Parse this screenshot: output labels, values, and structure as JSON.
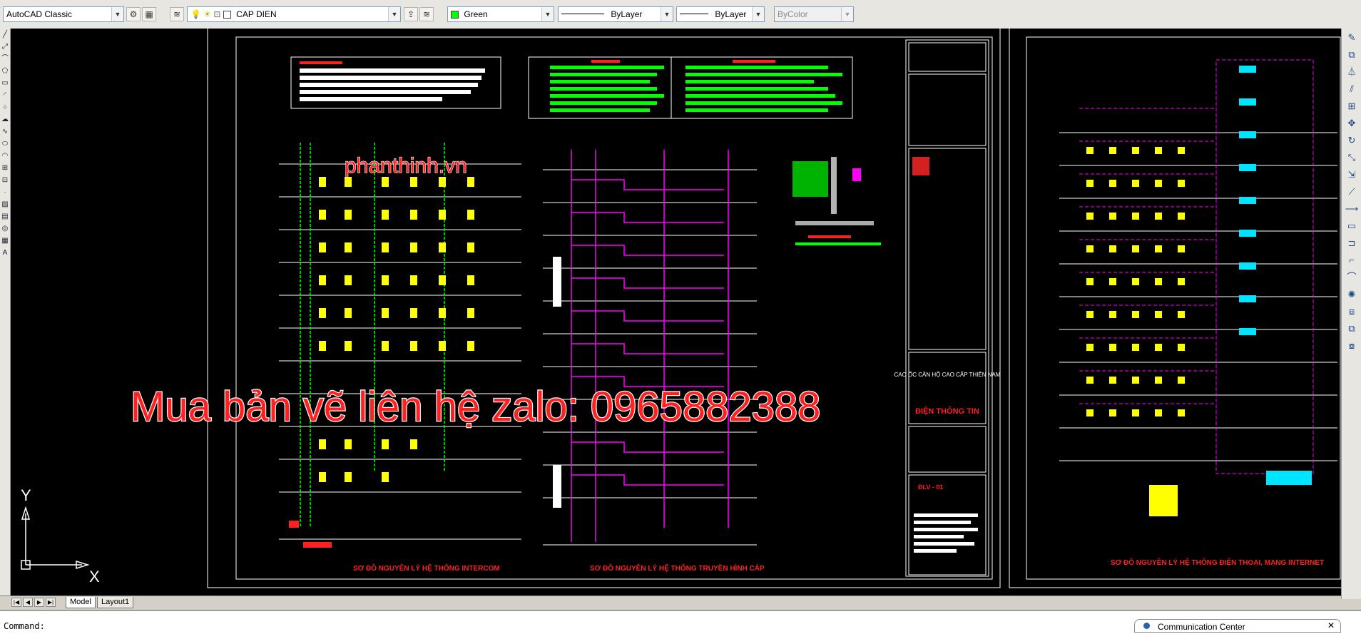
{
  "toolbar": {
    "workspace": "AutoCAD Classic",
    "layer": "CAP DIEN",
    "color": "Green",
    "color_hex": "#00ff00",
    "linetype": "ByLayer",
    "lineweight": "ByLayer",
    "plotstyle": "ByColor"
  },
  "tabs": {
    "model": "Model",
    "layout": "Layout1"
  },
  "command": {
    "prompt": "Command:"
  },
  "comm_center": {
    "label": "Communication Center"
  },
  "drawing": {
    "watermark_site": "phanthinh.vn",
    "watermark_contact": "Mua bản vẽ liên hệ zalo: 0965882388",
    "title_intercom": "SƠ ĐỒ NGUYÊN LÝ HỆ THỐNG INTERCOM",
    "title_tv": "SƠ ĐỒ NGUYÊN LÝ HỆ THỐNG TRUYỀN HÌNH CÁP",
    "title_phone": "SƠ ĐỒ NGUYÊN LÝ HỆ THỐNG ĐIỆN THOẠI, MẠNG INTERNET",
    "titleblock_project": "CAO ỐC CĂN HỘ CAO CẤP THIÊN NAM",
    "titleblock_dept": "ĐIỆN THÔNG TIN",
    "titleblock_code": "ĐLV - 01",
    "ucs_x": "X",
    "ucs_y": "Y"
  },
  "colors": {
    "canvas": "#000000",
    "green_wire": "#00ff00",
    "magenta_wire": "#ff00ff",
    "cyan": "#00e5ff",
    "yellow": "#ffff00",
    "red": "#ff2020"
  }
}
